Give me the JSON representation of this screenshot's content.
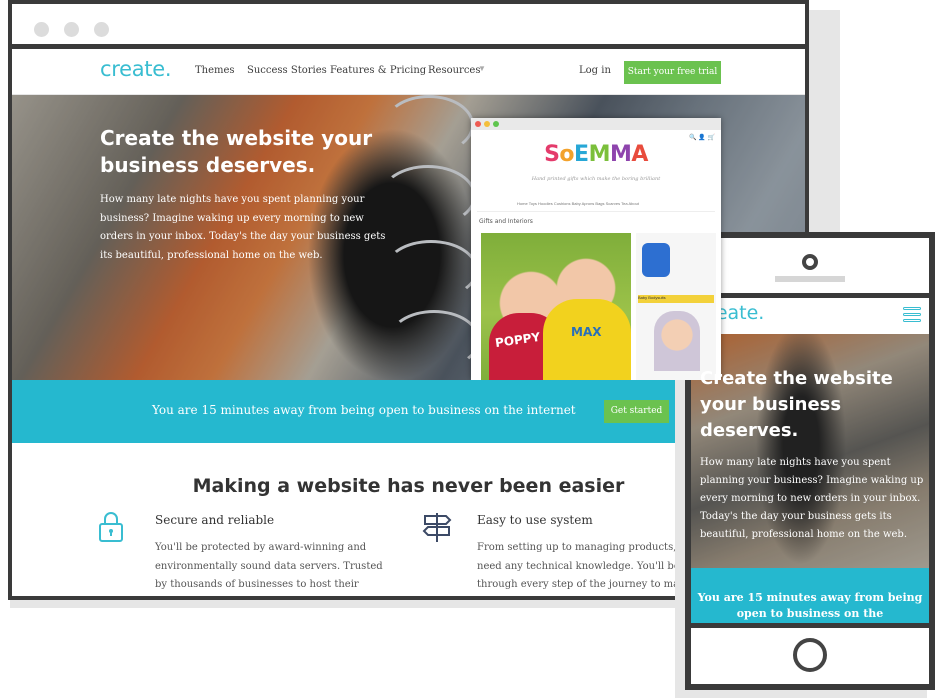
{
  "desktop": {
    "nav": {
      "logo": "create.",
      "links": [
        "Themes",
        "Success Stories",
        "Features & Pricing",
        "Resources"
      ],
      "login": "Log in",
      "trial_button": "Start your free trial"
    },
    "hero": {
      "title": "Create the website your business deserves.",
      "body": "How many late nights have you spent planning your business? Imagine waking up every morning to new orders in your inbox. Today's the day your business gets its beautiful, professional home on the web."
    },
    "preview": {
      "brand": "SoEMMA",
      "tagline": "Hand printed gifts which make the boring brilliant",
      "menu": "Home   Toys   Hoodies   Cushions   Baby   Aprons   Bags   Scarves   Tea   About",
      "section": "Gifts and Interiors",
      "shirt_left": "POPPY",
      "shirt_right": "MAX",
      "side_label": "Baby Bodysuits",
      "brand_colors": [
        "#e43b6b",
        "#f3a22b",
        "#27a7d6",
        "#7bbf3b",
        "#8e44ad",
        "#e84c3d"
      ]
    },
    "banner": {
      "text": "You are 15 minutes away from being open to business on the internet",
      "button": "Get started"
    },
    "features": {
      "title": "Making a website has never been easier",
      "items": [
        {
          "icon": "lock-icon",
          "heading": "Secure and reliable",
          "body": "You'll be protected by award-winning and environmentally sound data servers. Trusted by thousands of businesses to host their websites"
        },
        {
          "icon": "signpost-icon",
          "heading": "Easy to use system",
          "body": "From setting up to managing products, you d need any technical knowledge. You'll be guid through every step of the journey to making"
        }
      ]
    }
  },
  "mobile": {
    "logo": "create.",
    "hero_title": "Create the website your business deserves.",
    "hero_body": "How many late nights have you spent planning your business? Imagine waking up every morning to new orders in your inbox. Today's the day your business gets its beautiful, professional home on the web.",
    "banner_text": "You are 15 minutes away from being open to business on the"
  },
  "colors": {
    "brand_cyan": "#39bdd1",
    "banner_cyan": "#25b8cf",
    "cta_green": "#6bc24f",
    "frame_gray": "#3a3a3a"
  }
}
